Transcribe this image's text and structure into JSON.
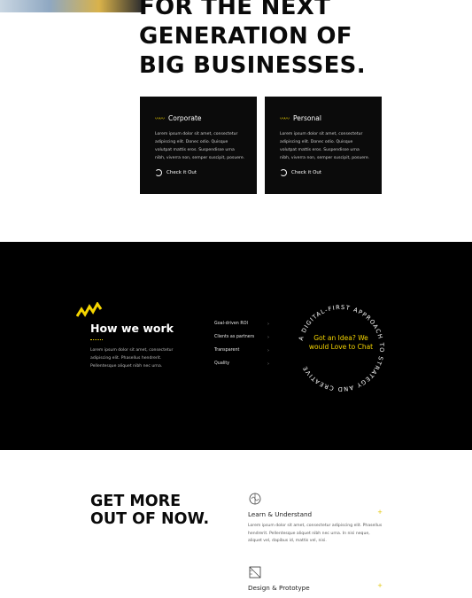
{
  "hero": {
    "heading_lines": [
      "FOR THE NEXT",
      "GENERATION OF",
      "BIG BUSINESSES."
    ]
  },
  "cards": [
    {
      "title": "Corporate",
      "body": "Lorem ipsum dolor sit amet, consectetur adipiscing elit. Donec odio. Quisque volutpat mattis eros. Suspendisse urna nibh, viverra non, semper suscipit, posuere.",
      "link_label": "Check it Out"
    },
    {
      "title": "Personal",
      "body": "Lorem ipsum dolor sit amet, consectetur adipiscing elit. Donec odio. Quisque volutpat mattis eros. Suspendisse urna nibh, viverra non, semper suscipit, posuere.",
      "link_label": "Check it Out"
    }
  ],
  "how_we_work": {
    "title": "How we work",
    "body": "Lorem ipsum dolor sit amet, consectetur adipiscing elit. Phasellus hendrerit. Pellentesque aliquet nibh nec urna.",
    "list": [
      "Goal-driven ROI",
      "Clients as partners",
      "Transparent",
      "Quality"
    ],
    "circle_text": "A DIGITAL-FIRST APPROACH TO STRATEGY AND CREATIVE",
    "cta": "Got an Idea? We would Love to Chat"
  },
  "get_more": {
    "title_lines": [
      "GET MORE",
      "OUT OF NOW."
    ],
    "features": [
      {
        "title": "Learn & Understand",
        "icon": "brain-icon",
        "body": "Lorem ipsum dolor sit amet, consectetur adipiscing elit. Phasellus hendrerit. Pellentesque aliquet nibh nec urna. In nisi neque, aliquet vel, dapibus id, mattis vel, nisi."
      },
      {
        "title": "Design & Prototype",
        "icon": "ruler-icon",
        "body": ""
      }
    ],
    "plus_symbol": "+"
  },
  "colors": {
    "accent": "#f5d500",
    "band": "#000000",
    "card": "#0b0b0b"
  }
}
